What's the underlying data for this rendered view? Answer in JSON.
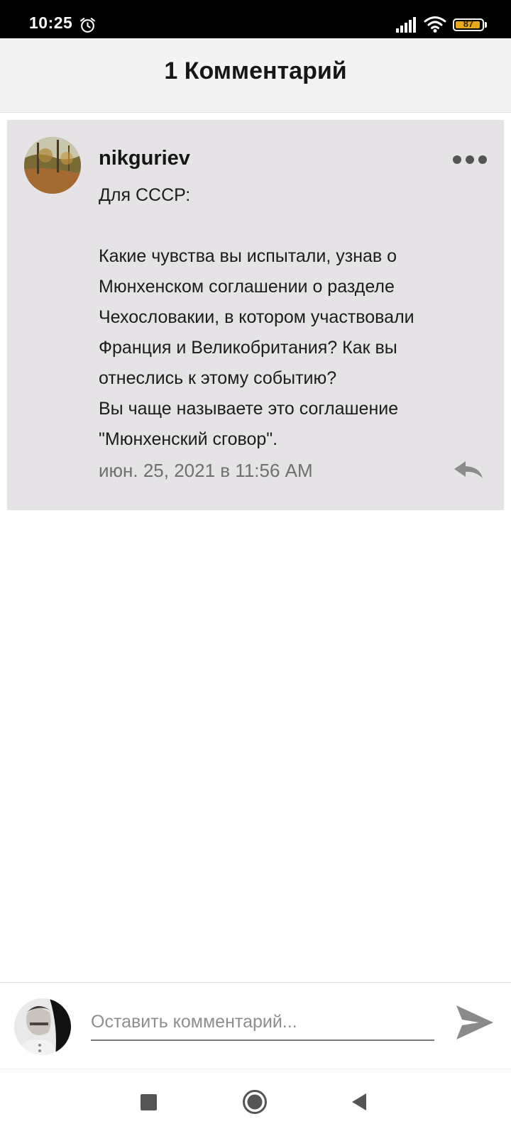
{
  "status_bar": {
    "time": "10:25",
    "battery_level": "87",
    "icons": [
      "alarm-icon",
      "signal-icon",
      "wifi-icon",
      "battery-icon"
    ]
  },
  "header": {
    "title": "1 Комментарий"
  },
  "comment": {
    "author": "nikguriev",
    "avatar_icon": "autumn-forest-avatar",
    "paragraphs": [
      "Для СССР:",
      "Какие чувства вы испытали, узнав о Мюнхенском соглашении о разделе Чехословакии, в котором участвовали Франция и Великобритания? Как вы отнеслись к этому событию?\nВы чаще называете это соглашение \"Мюнхенский сговор\"."
    ],
    "timestamp": "июн. 25, 2021 в 11:56 AM",
    "more_icon": "more-dots-icon",
    "reply_icon": "reply-icon"
  },
  "composer": {
    "placeholder": "Оставить комментарий...",
    "avatar_icon": "user-portrait-avatar",
    "send_icon": "send-icon"
  },
  "nav": {
    "icons": [
      "recents-icon",
      "home-icon",
      "back-icon"
    ]
  },
  "colors": {
    "header_bg": "#f4f3f4",
    "card_bg": "#e5e3e6",
    "battery_fill": "#e8a91a",
    "muted_text": "#707070"
  }
}
